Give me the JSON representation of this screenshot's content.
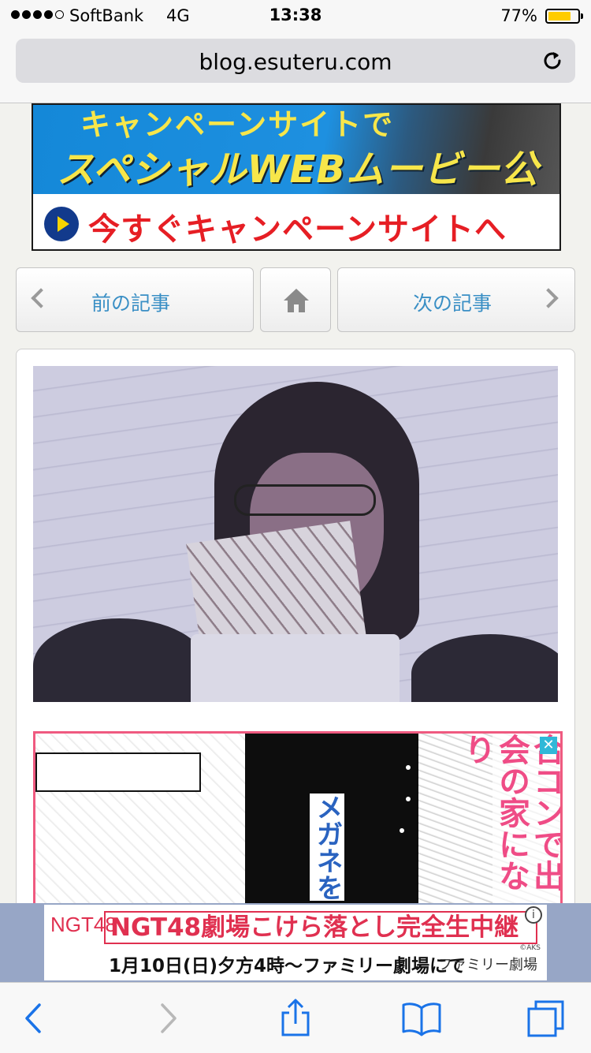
{
  "status_bar": {
    "carrier": "SoftBank",
    "network": "4G",
    "time": "13:38",
    "battery_percent_label": "77%",
    "battery_level": 0.77,
    "signal_bars_filled": 4,
    "signal_bars_total": 5
  },
  "browser": {
    "url": "blog.esuteru.com",
    "reload_icon": "reload-icon"
  },
  "top_banner": {
    "line1": "キャンペーンサイトで",
    "line2": "スペシャルWEBムービー公開中！",
    "cta": "今すぐキャンペーンサイトへGO！",
    "accent_color": "#f7e64a",
    "cta_color": "#e61e24"
  },
  "article_nav": {
    "prev_label": "前の記事",
    "next_label": "次の記事",
    "home_icon": "home-icon"
  },
  "manga_ad": {
    "left_text": "メガネを",
    "right_text": "合コンで出会の家になり",
    "border_color": "#ef5a80"
  },
  "bottom_ad": {
    "logo": "NGT48",
    "title": "NGT48劇場こけら落とし完全生中継",
    "subtitle": "1月10日(日)夕方4時〜ファミリー劇場にて",
    "brand": "ファミリー劇場",
    "copyright": "©AKS",
    "info_icon": "info-icon"
  },
  "toolbar": {
    "icons": [
      "back-icon",
      "forward-icon",
      "share-icon",
      "bookmarks-icon",
      "tabs-icon"
    ]
  }
}
